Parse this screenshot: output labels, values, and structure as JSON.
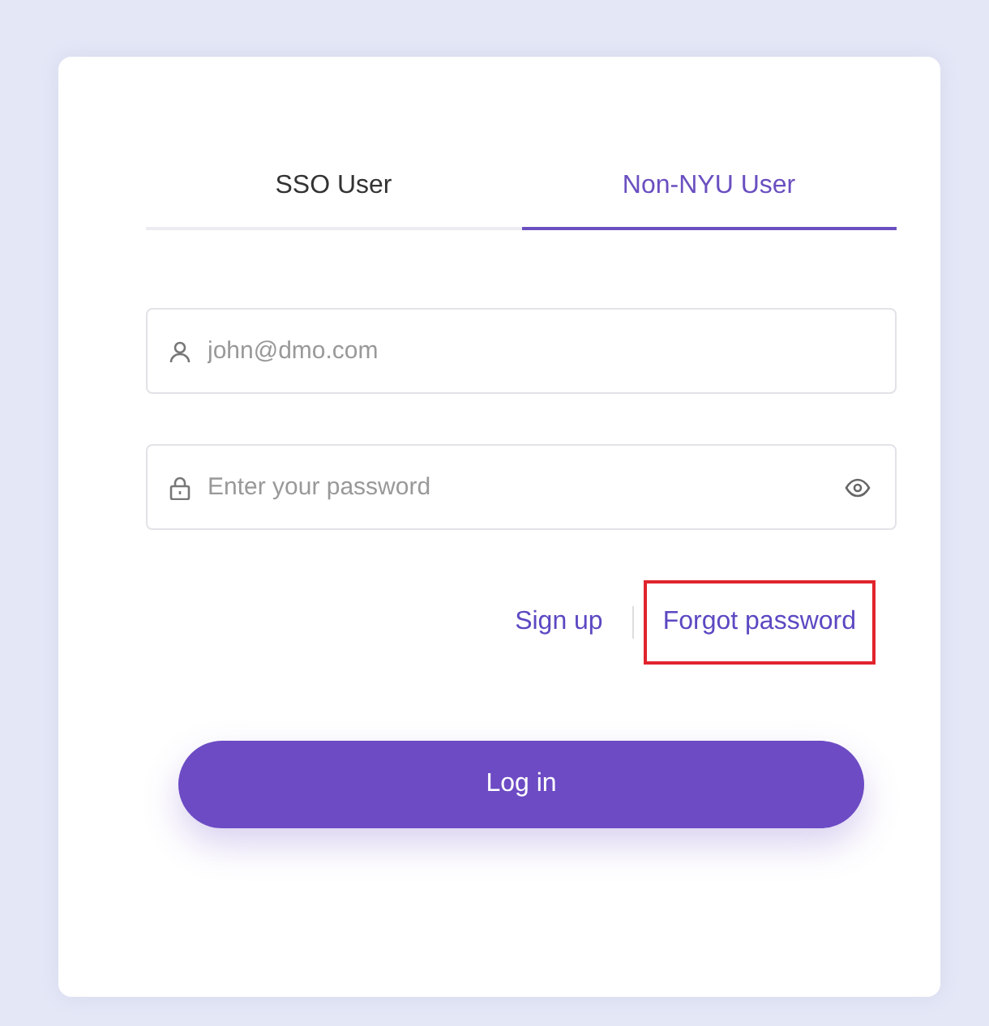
{
  "tabs": [
    {
      "label": "SSO User",
      "selected": false
    },
    {
      "label": "Non-NYU User",
      "selected": true
    }
  ],
  "email": {
    "placeholder": "john@dmo.com"
  },
  "password": {
    "placeholder": "Enter your password"
  },
  "links": [
    {
      "label": "Sign up",
      "highlighted": false
    },
    {
      "label": "Forgot password",
      "highlighted": true
    }
  ],
  "login_button": "Log in"
}
